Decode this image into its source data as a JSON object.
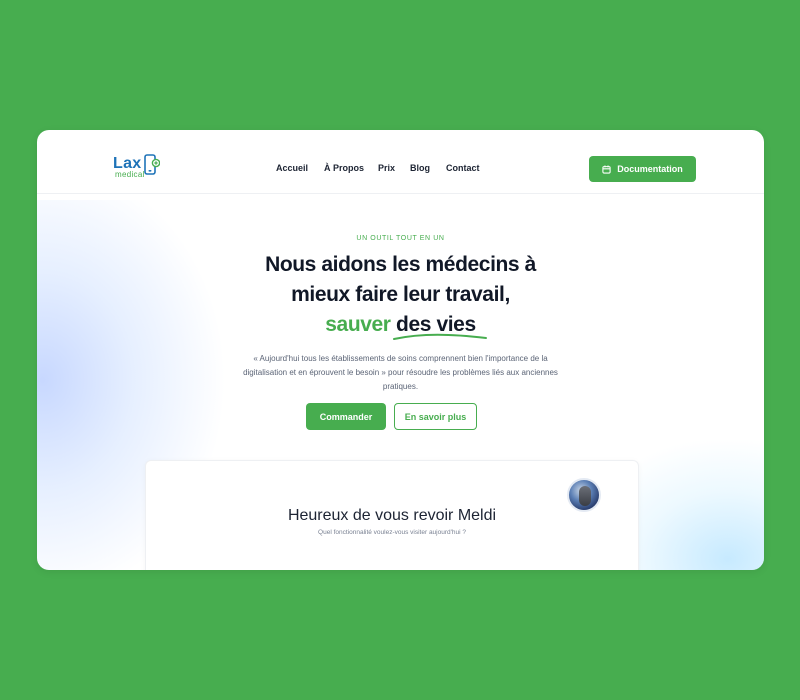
{
  "brand": {
    "name": "Lax",
    "subname": "medical"
  },
  "nav": {
    "items": [
      {
        "label": "Accueil"
      },
      {
        "label": "À Propos"
      },
      {
        "label": "Prix"
      },
      {
        "label": "Blog"
      },
      {
        "label": "Contact"
      }
    ]
  },
  "header": {
    "documentation_label": "Documentation"
  },
  "hero": {
    "tagline": "UN OUTIL TOUT EN UN",
    "title_line1": "Nous aidons les médecins à",
    "title_line2": "mieux faire leur travail,",
    "title_line3_green": "sauver",
    "title_line3_rest": "des vies",
    "description": "« Aujourd'hui tous les établissements de soins comprennent bien l'importance de la digitalisation et en éprouvent le besoin » pour résoudre les problèmes liés aux anciennes pratiques.",
    "primary_button": "Commander",
    "secondary_button": "En savoir plus"
  },
  "card": {
    "title": "Heureux de vous revoir Meldi",
    "subtitle": "Quel fonctionnalité voulez-vous visiter aujourd'hui ?"
  },
  "colors": {
    "background": "#47ad4f",
    "accent": "#47ad4f",
    "brand_blue": "#1e73b8",
    "text_dark": "#111827"
  }
}
